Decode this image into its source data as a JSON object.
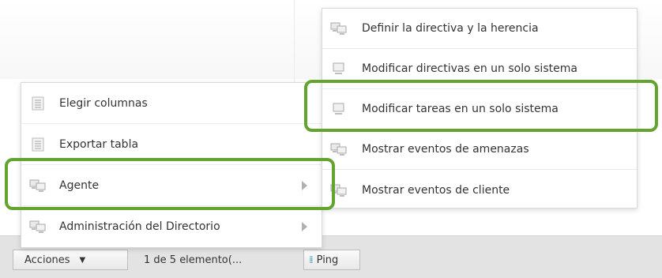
{
  "left_menu": {
    "items": [
      {
        "label": "Elegir columnas",
        "icon": "list-icon"
      },
      {
        "label": "Exportar tabla",
        "icon": "list-icon"
      },
      {
        "label": "Agente",
        "icon": "monitors-icon",
        "submenu": true
      },
      {
        "label": "Administración del Directorio",
        "icon": "monitors-icon",
        "submenu": true
      }
    ]
  },
  "right_menu": {
    "items": [
      {
        "label": "Definir la directiva y la herencia",
        "icon": "monitors-icon"
      },
      {
        "label": "Modificar directivas en un solo sistema",
        "icon": "monitor-icon"
      },
      {
        "label": "Modificar tareas en un solo sistema",
        "icon": "monitor-icon"
      },
      {
        "label": "Mostrar eventos de amenazas",
        "icon": "monitors-icon"
      },
      {
        "label": "Mostrar eventos de cliente",
        "icon": "monitors-icon"
      }
    ]
  },
  "toolbar": {
    "actions_label": "Acciones",
    "count_text": "1 de 5 elemento(...",
    "ping_label": "Ping"
  },
  "colors": {
    "highlight": "#63a42f",
    "toolbar_bg": "#e3e3e3",
    "text": "#333333"
  }
}
